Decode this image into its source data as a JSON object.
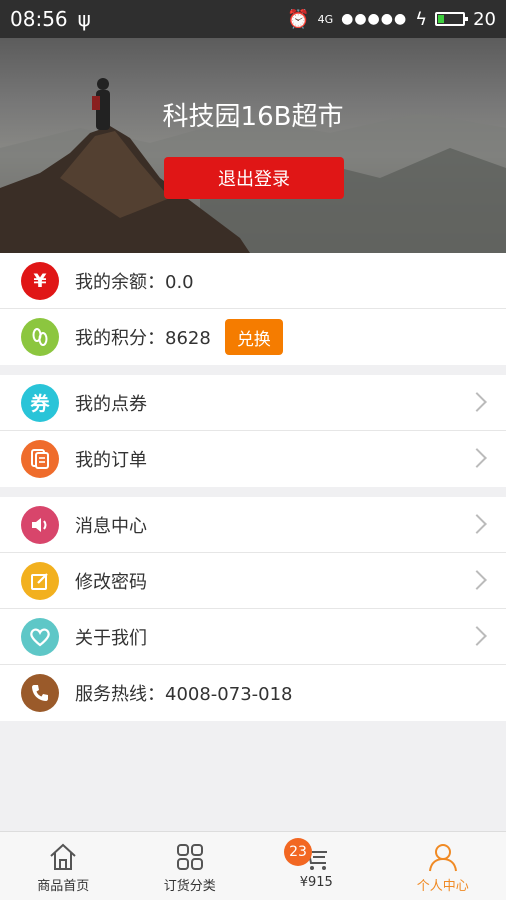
{
  "status_bar": {
    "time": "08:56",
    "network": "4G",
    "signal_dots": "●●●●●",
    "battery": "20"
  },
  "banner": {
    "store_name": "科技园16B超市",
    "logout_label": "退出登录"
  },
  "account": {
    "balance_label": "我的余额：0.0",
    "points_label": "我的积分：8628",
    "exchange_label": "兑换"
  },
  "coupons": {
    "label": "我的点券"
  },
  "orders": {
    "label": "我的订单"
  },
  "menu": {
    "messages": "消息中心",
    "password": "修改密码",
    "about": "关于我们",
    "hotline": "服务热线：4008-073-018"
  },
  "icons": {
    "yuan": "¥",
    "coupon": "券"
  },
  "colors": {
    "balance_icon": "#e01616",
    "points_icon": "#8cc63f",
    "coupon_icon": "#29c4d8",
    "order_icon": "#ef6c2c",
    "message_icon": "#d8456b",
    "password_icon": "#f2b01e",
    "about_icon": "#5ec7c7",
    "hotline_icon": "#9a5a2a",
    "active_tab": "#f08a24"
  },
  "bottom_nav": {
    "home": "商品首页",
    "category": "订货分类",
    "cart": "¥915",
    "cart_badge": "23",
    "profile": "个人中心"
  }
}
